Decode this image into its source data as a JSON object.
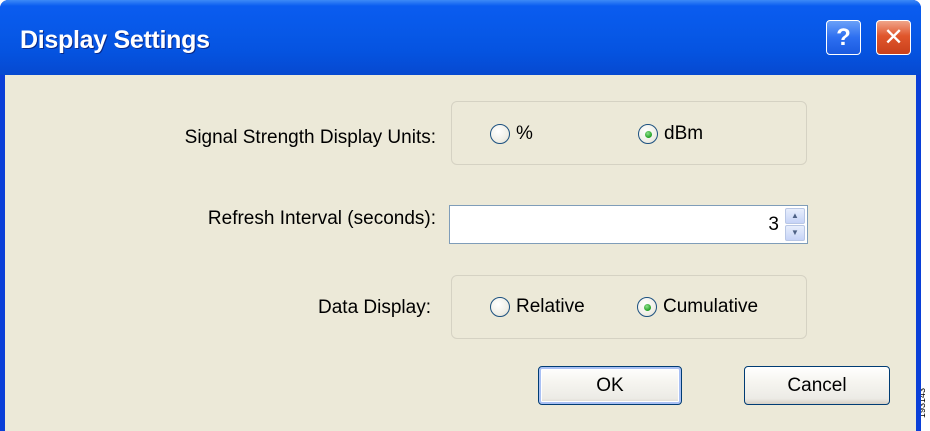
{
  "window": {
    "title": "Display Settings",
    "help_button": "?",
    "close_button": "✕"
  },
  "signal_strength": {
    "label": "Signal Strength Display Units:",
    "options": [
      {
        "label": "%",
        "checked": false
      },
      {
        "label": "dBm",
        "checked": true
      }
    ]
  },
  "refresh_interval": {
    "label": "Refresh Interval (seconds):",
    "value": "3"
  },
  "data_display": {
    "label": "Data Display:",
    "options": [
      {
        "label": "Relative",
        "checked": false
      },
      {
        "label": "Cumulative",
        "checked": true
      }
    ]
  },
  "buttons": {
    "ok_label": "OK",
    "cancel_label": "Cancel"
  },
  "watermark": {
    "text": "193143"
  },
  "colors": {
    "titlebar": "#0553e0",
    "client_bg": "#ece9d8",
    "close_button": "#e0562c",
    "radio_checked": "#21a121"
  }
}
